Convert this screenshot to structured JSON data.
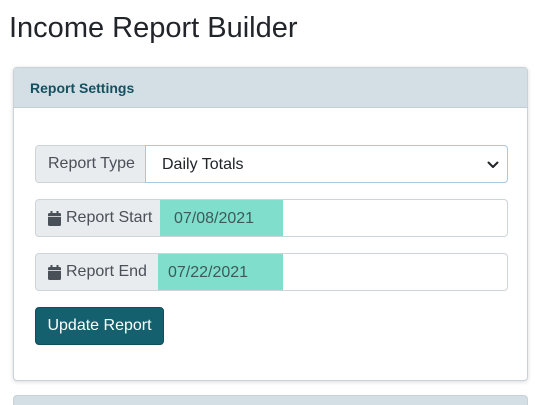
{
  "page": {
    "title": "Income Report Builder"
  },
  "settings_card": {
    "title": "Report Settings",
    "report_type": {
      "label": "Report Type",
      "selected": "Daily Totals"
    },
    "report_start": {
      "label": "Report Start",
      "value": "07/08/2021",
      "icon": "calendar-icon"
    },
    "report_end": {
      "label": "Report End",
      "value": "07/22/2021",
      "icon": "calendar-icon"
    },
    "update_button": "Update Report"
  },
  "colors": {
    "header_bg": "#d3dfe5",
    "header_text": "#14505f",
    "button_bg": "#14606e",
    "date_highlight": "#7fdfcc"
  }
}
